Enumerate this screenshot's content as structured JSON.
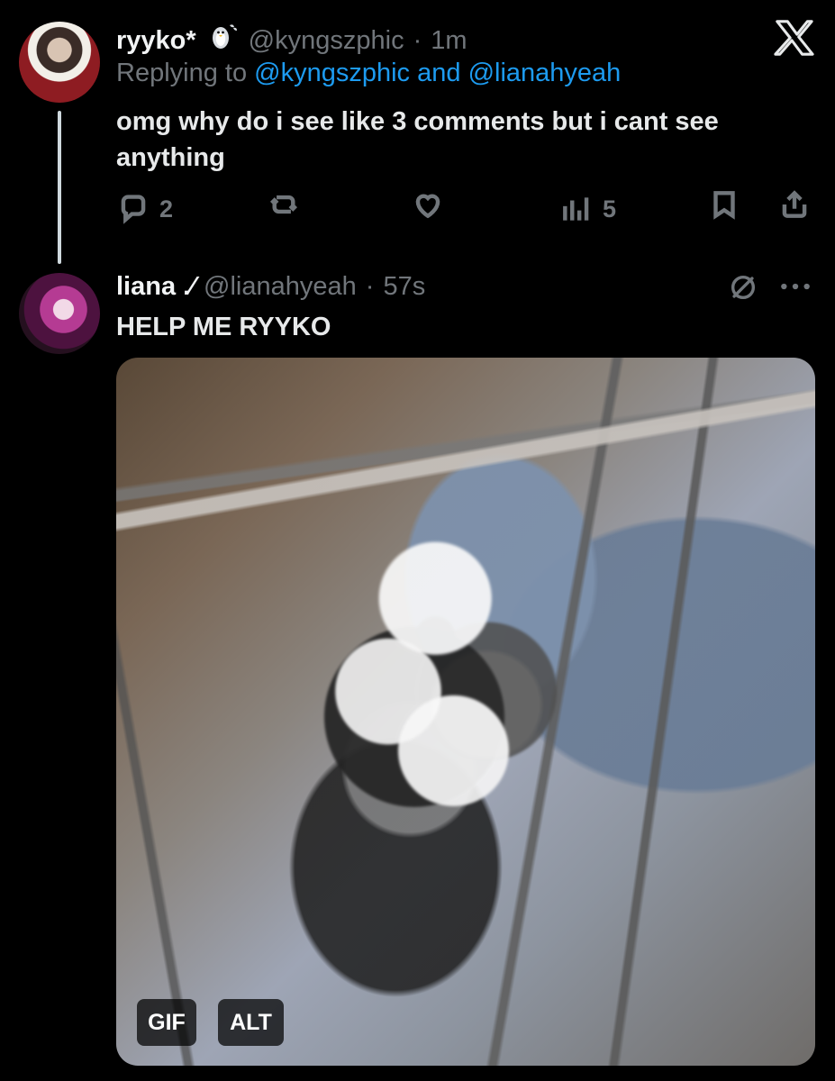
{
  "tweet1": {
    "display_name": "ryyko*",
    "emoji_icon": "penguin-icon",
    "handle": "@kyngszphic",
    "time": "1m",
    "replying_prefix": "Replying to",
    "replying_target_1": "@kyngszphic",
    "replying_and": "and",
    "replying_target_2": "@lianahyeah",
    "text": "omg why do i see like 3 comments but i cant see anything",
    "actions": {
      "reply_count": "2",
      "views_count": "5"
    }
  },
  "tweet2": {
    "display_name": "liana .⁄",
    "handle": "@lianahyeah",
    "time": "57s",
    "text": "HELP ME RYYKO",
    "media_badges": {
      "gif": "GIF",
      "alt": "ALT"
    }
  },
  "icons": {
    "top_right": "x-logo",
    "tweet1_actions": [
      "reply-icon",
      "repost-icon",
      "like-icon",
      "views-icon",
      "bookmark-icon",
      "share-icon"
    ],
    "tweet2_header": [
      "grok-icon",
      "more-icon"
    ]
  },
  "colors": {
    "background": "#000000",
    "text_primary": "#e7e9ea",
    "text_secondary": "#71767b",
    "link": "#1d9bf0"
  }
}
